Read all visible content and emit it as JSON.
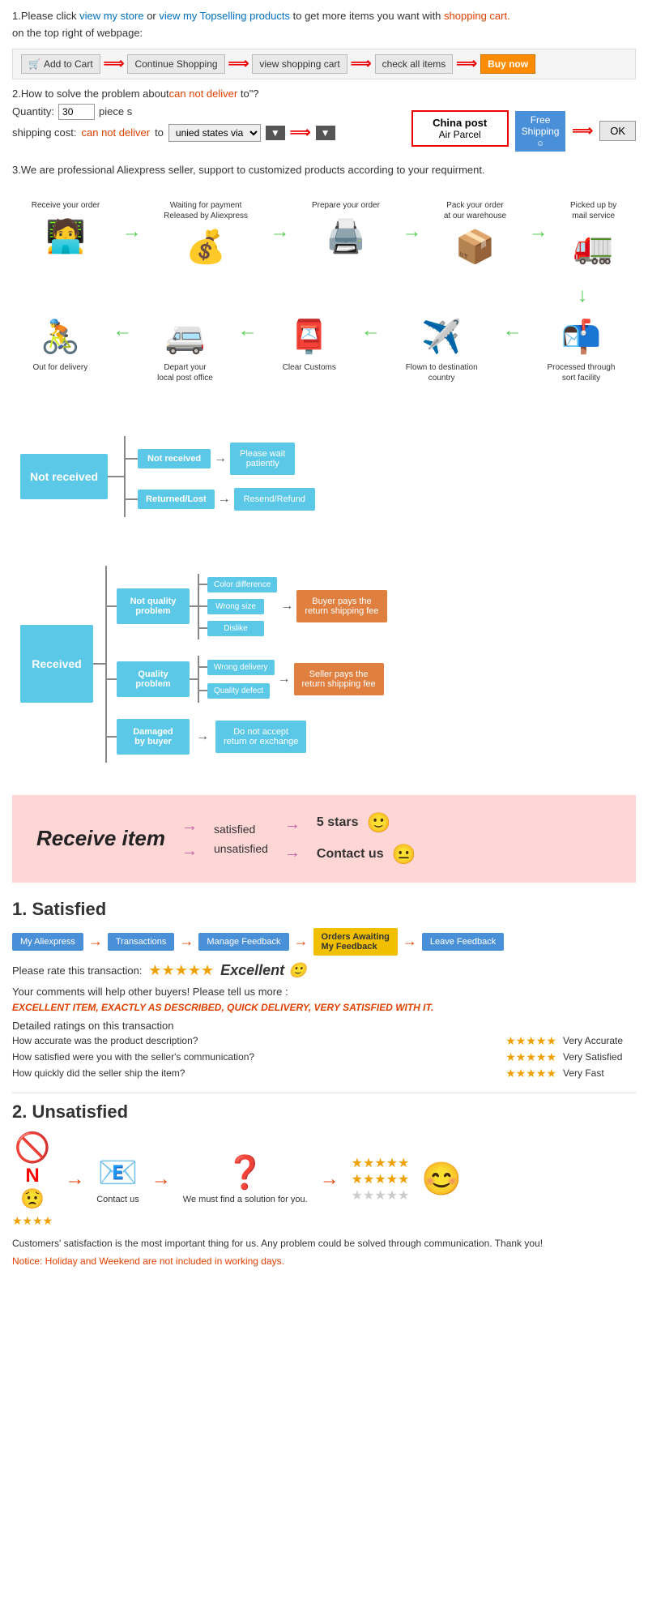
{
  "page": {
    "section1": {
      "line1_pre": "1.Please click ",
      "link1": "view my store",
      "line1_mid": "or ",
      "link2": "view my Topselling products",
      "line1_post": " to get more items you want with",
      "line1_red": "shopping cart.",
      "line2": "on the top right of webpage:",
      "btn_add": "Add to Cart",
      "btn_continue": "Continue Shopping",
      "btn_view": "view shopping cart",
      "btn_check": "check all items",
      "btn_buy": "Buy now"
    },
    "section2": {
      "title": "2.How to solve the problem about",
      "title_red": "can not deliver",
      "title_post": " to\"?",
      "qty_label": "Quantity:",
      "qty_value": "30",
      "qty_unit": "piece s",
      "shipping_pre": "shipping cost:",
      "shipping_red": "can not deliver",
      "shipping_mid": " to ",
      "shipping_select": "unied states via",
      "china_post_title": "China post",
      "china_post_sub": "Air Parcel",
      "free_shipping": "Free\nShipping",
      "ok_btn": "OK"
    },
    "section3": {
      "text": "3.We are professional Aliexpress seller, support to customized products according to your requirment."
    },
    "process": {
      "row1": [
        {
          "label": "Receive your order",
          "icon": "🧑‍💻"
        },
        {
          "label": "Waiting for payment\nReleased by Aliexpress",
          "icon": "💰"
        },
        {
          "label": "Prepare your order",
          "icon": "🖨️"
        },
        {
          "label": "Pack your order\nat our warehouse",
          "icon": "📦"
        },
        {
          "label": "Picked up by\nmail service",
          "icon": "🚛"
        }
      ],
      "row2": [
        {
          "label": "Out for delivery",
          "icon": "🚴"
        },
        {
          "label": "Depart your\nlocal post office",
          "icon": "🚐"
        },
        {
          "label": "Clear Customs",
          "icon": "📮"
        },
        {
          "label": "Flown to destination\ncountry",
          "icon": "✈️"
        },
        {
          "label": "Processed through\nsort facility",
          "icon": "📬"
        }
      ]
    },
    "not_received_chart": {
      "main_label": "Not received",
      "branch1_label": "Not received",
      "branch1_result": "Please wait\npatiently",
      "branch2_label": "Returned/Lost",
      "branch2_result": "Resend/Refund"
    },
    "received_chart": {
      "main_label": "Received",
      "branch1": {
        "label": "Not quality\nproblem",
        "sub": [
          "Color difference",
          "Wrong size",
          "Dislike"
        ],
        "result": "Buyer pays the\nreturn shipping fee"
      },
      "branch2": {
        "label": "Quality\nproblem",
        "sub": [
          "Wrong delivery",
          "Quality defect"
        ],
        "result": "Seller pays the\nreturn shipping fee"
      },
      "branch3": {
        "label": "Damaged\nby buyer",
        "result": "Do not accept\nreturn or exchange"
      }
    },
    "pink_section": {
      "title": "Receive item",
      "row1_text": "satisfied",
      "row1_result": "5 stars",
      "row1_emoji": "🙂",
      "row2_text": "unsatisfied",
      "row2_result": "Contact us",
      "row2_emoji": "😐"
    },
    "satisfied": {
      "title": "1. Satisfied",
      "flow": [
        "My Aliexpress",
        "Transactions",
        "Manage Feedback",
        "Orders Awaiting\nMy Feedback",
        "Leave Feedback"
      ],
      "rate_text": "Please rate this transaction:",
      "stars": "★★★★★",
      "excellent": "Excellent 🙂",
      "comment_text": "Your comments will help other buyers! Please tell us more :",
      "excellent_item": "EXCELLENT ITEM, EXACTLY AS DESCRIBED, QUICK DELIVERY, VERY SATISFIED WITH IT.",
      "detailed_title": "Detailed ratings on this transaction",
      "ratings": [
        {
          "label": "How accurate was the product description?",
          "stars": "★★★★★",
          "desc": "Very Accurate"
        },
        {
          "label": "How satisfied were you with the seller's communication?",
          "stars": "★★★★★",
          "desc": "Very Satisfied"
        },
        {
          "label": "How quickly did the seller ship the item?",
          "stars": "★★★★★",
          "desc": "Very Fast"
        }
      ]
    },
    "unsatisfied": {
      "title": "2. Unsatisfied",
      "icons": [
        "🚫",
        "😟",
        "📧",
        "❓",
        "⭐"
      ],
      "contact_label": "Contact us",
      "find_label": "We must find\na solution for\nyou.",
      "footnote": "Customers' satisfaction is the most important thing for us. Any problem could be solved through\ncommunication. Thank you!",
      "notice": "Notice: Holiday and Weekend are not included in working days."
    }
  }
}
